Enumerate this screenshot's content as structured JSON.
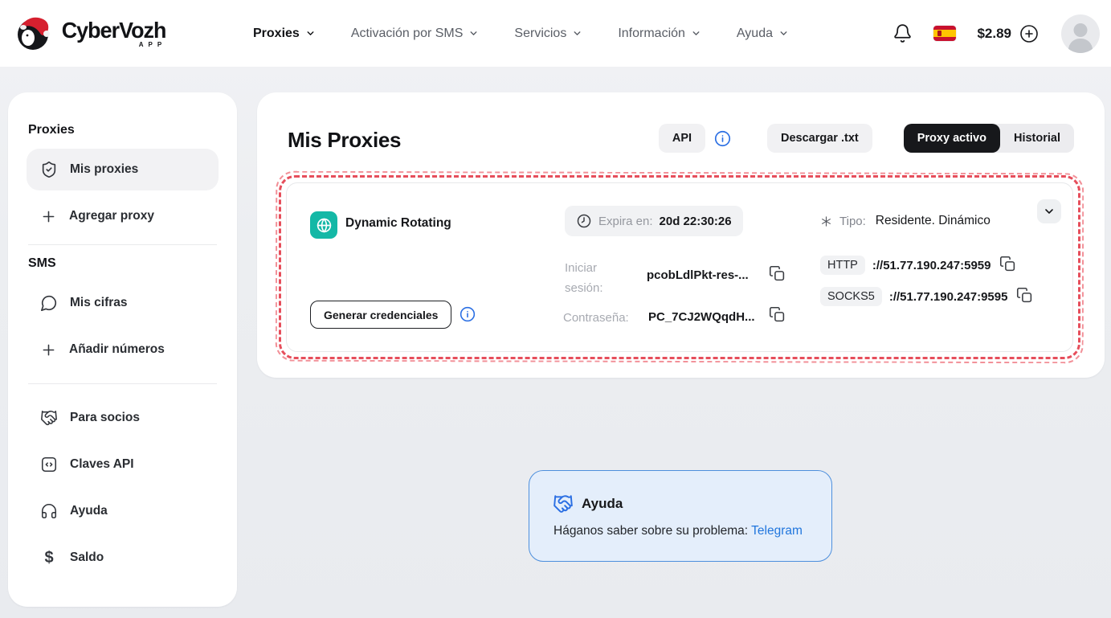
{
  "header": {
    "brand": "CyberVozh",
    "brand_sub": "APP",
    "nav": [
      {
        "label": "Proxies"
      },
      {
        "label": "Activación por SMS"
      },
      {
        "label": "Servicios"
      },
      {
        "label": "Información"
      },
      {
        "label": "Ayuda"
      }
    ],
    "balance": "$2.89"
  },
  "sidebar": {
    "proxies_heading": "Proxies",
    "mis_proxies": "Mis proxies",
    "agregar_proxy": "Agregar proxy",
    "sms_heading": "SMS",
    "mis_cifras": "Mis cifras",
    "anadir_numeros": "Añadir números",
    "para_socios": "Para socios",
    "claves_api": "Claves API",
    "ayuda": "Ayuda",
    "saldo": "Saldo"
  },
  "main": {
    "title": "Mis Proxies",
    "api_button": "API",
    "download_button": "Descargar .txt",
    "tab_active": "Proxy activo",
    "tab_history": "Historial"
  },
  "proxy": {
    "name": "Dynamic Rotating",
    "expires_label": "Expira en:",
    "expires_value": "20d 22:30:26",
    "type_label": "Tipo:",
    "type_value": "Residente. Dinámico",
    "login_label": "Iniciar sesión:",
    "login_value": "pcobLdlPkt-res-...",
    "password_label": "Contraseña:",
    "password_value": "PC_7CJ2WQqdH...",
    "http_label": "HTTP",
    "http_value": "://51.77.190.247:5959",
    "socks_label": "SOCKS5",
    "socks_value": "://51.77.190.247:9595",
    "generate_button": "Generar credenciales"
  },
  "help": {
    "title": "Ayuda",
    "text": "Háganos saber sobre su problema: ",
    "link": "Telegram"
  },
  "colors": {
    "accent_blue": "#2b6fe3",
    "teal": "#14b8a6",
    "red_outline": "#e4404e",
    "black_button": "#17181b"
  }
}
